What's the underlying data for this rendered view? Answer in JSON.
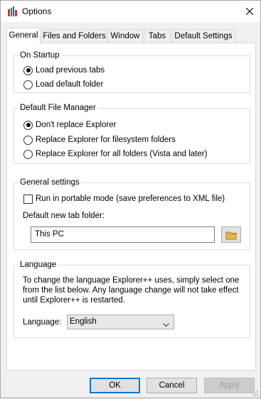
{
  "window": {
    "title": "Options",
    "close_icon": "close-icon",
    "app_icon": "explorerpp-app-icon"
  },
  "tabs": [
    {
      "label": "General",
      "active": true
    },
    {
      "label": "Files and Folders",
      "active": false
    },
    {
      "label": "Window",
      "active": false
    },
    {
      "label": "Tabs",
      "active": false
    },
    {
      "label": "Default Settings",
      "active": false
    }
  ],
  "startup": {
    "title": "On Startup",
    "options": [
      {
        "label": "Load previous tabs",
        "checked": true
      },
      {
        "label": "Load default folder",
        "checked": false
      }
    ]
  },
  "file_manager": {
    "title": "Default File Manager",
    "options": [
      {
        "label": "Don't replace Explorer",
        "checked": true
      },
      {
        "label": "Replace Explorer for filesystem folders",
        "checked": false
      },
      {
        "label": "Replace Explorer for all folders (Vista and later)",
        "checked": false
      }
    ]
  },
  "general_settings": {
    "title": "General settings",
    "portable_label": "Run in portable mode (save preferences to XML file)",
    "portable_checked": false,
    "new_tab_label": "Default new tab folder:",
    "new_tab_value": "This PC",
    "browse_icon": "folder-icon"
  },
  "language": {
    "title": "Language",
    "description": "To change the language Explorer++ uses, simply select one from the list below. Any language change will not take effect until Explorer++ is restarted.",
    "label": "Language:",
    "selected": "English"
  },
  "buttons": {
    "ok": "OK",
    "cancel": "Cancel",
    "apply": "Apply"
  },
  "colors": {
    "accent": "#0078d7",
    "background": "#f0f0f0",
    "panel": "#ffffff"
  }
}
